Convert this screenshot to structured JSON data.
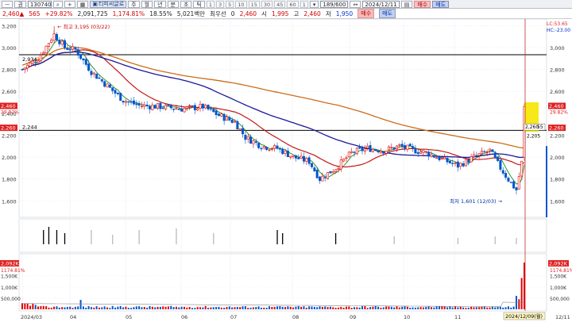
{
  "toolbar": {
    "period_btn": "ᅳ",
    "market_label": "권",
    "code": "130740",
    "icons": [
      "search-icon",
      "plus-icon",
      "chart-icon",
      "prev-icon",
      "next-icon"
    ],
    "stock_name": "티피씨글로",
    "period_tabs": [
      "주",
      "월",
      "년",
      "분",
      "초",
      "틱"
    ],
    "intervals": [
      "1",
      "3",
      "5",
      "10",
      "15",
      "30",
      "45",
      "60",
      "1"
    ],
    "count": "189/600",
    "date": "2024/12/11",
    "buy_label": "매수",
    "sell_label": "매도"
  },
  "quote": {
    "price": "2,460",
    "change": "565",
    "change_pct": "+29.82%",
    "volume": "2,091,725",
    "vol_ratio": "1,174.81%",
    "turnover": "18.55%",
    "amount": "5,021백만",
    "priority_label": "최우선",
    "priority_value": "0",
    "current": "2,460",
    "open_label": "시",
    "open": "1,995",
    "high_label": "고",
    "high": "2,460",
    "low_label": "저",
    "low": "1,950",
    "buy_label": "매수",
    "sell_label": "매도"
  },
  "price_axis": {
    "ticks": [
      "3,200",
      "3,000",
      "2,800",
      "2,600",
      "2,400",
      "2,200",
      "2,000",
      "1,800",
      "1,600"
    ],
    "right_ticks": [
      "3,000",
      "2,800",
      "2,600",
      "2,200",
      "2,000",
      "1,800",
      "1,600"
    ],
    "lc_label": "LC:53.65",
    "hc_label": "HC:-23.00",
    "current_tag": "2,460",
    "current_pct": "29.82%",
    "ref_tag": "2,260",
    "left_current_tag": "2,460",
    "left_pct": "29.82%",
    "left_ref": "2,260"
  },
  "annotations": {
    "high": "최고 3,195 (03/22)",
    "low": "최저 1,601 (12/03)",
    "line_2934": "2,934",
    "line_2244": "2,244",
    "box_2260": "2,260",
    "box_55": "55",
    "box_2205": "2,205"
  },
  "volume_axis": {
    "left_ticks": [
      "1,500K",
      "1,000K",
      "500,000"
    ],
    "right_ticks": [
      "1,500K",
      "1,000K",
      "500,000"
    ],
    "left_tag": "2,092K",
    "left_pct": "1174.81%",
    "right_tag": "2,092K",
    "right_pct": "1174.81%"
  },
  "x_axis": {
    "labels": [
      "2024/03",
      "04",
      "05",
      "06",
      "07",
      "08",
      "09",
      "10",
      "11"
    ],
    "cursor_date": "2024/12/09(월)",
    "end_label": "12/11"
  },
  "colors": {
    "up": "#e00000",
    "down": "#0055cc",
    "ma_short": "#1a8a1a",
    "ma_mid": "#c41818",
    "ma_long": "#1a1a99",
    "ma_xlong": "#cc6d1a",
    "highlight": "#f5e600"
  }
}
